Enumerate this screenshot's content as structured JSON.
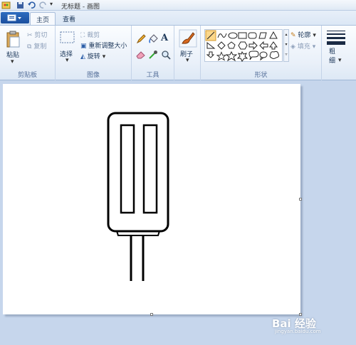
{
  "window": {
    "title": "无标题 - 画图"
  },
  "tabs": [
    {
      "label": "主页",
      "active": true
    },
    {
      "label": "查看",
      "active": false
    }
  ],
  "ribbon": {
    "clipboard": {
      "paste": "粘贴",
      "cut": "剪切",
      "copy": "复制",
      "group_label": "剪贴板"
    },
    "image": {
      "select": "选择",
      "crop": "裁剪",
      "resize": "重新调整大小",
      "rotate": "旋转",
      "group_label": "图像"
    },
    "tools": {
      "group_label": "工具"
    },
    "brushes": {
      "label": "刷子"
    },
    "shapes": {
      "outline": "轮廓",
      "fill": "填充",
      "group_label": "形状"
    },
    "size": {
      "label": "粗细"
    }
  },
  "watermark": {
    "text": "Bai 经验",
    "sub": "jingyan.baidu.com"
  },
  "colors": {
    "accent": "#1b4f9e",
    "ribbon_bg": "#e9f0f9",
    "canvas": "#ffffff"
  }
}
